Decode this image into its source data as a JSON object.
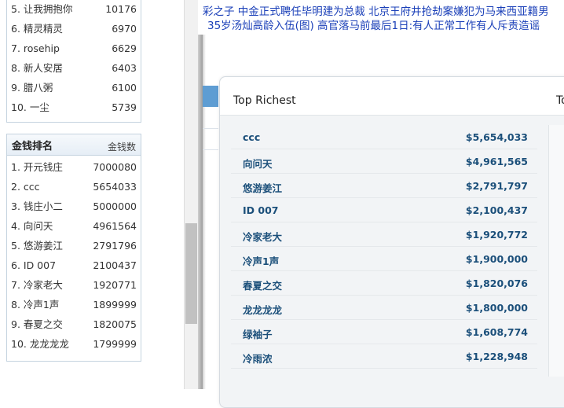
{
  "left_top_list": {
    "rows": [
      {
        "rank_name": "5. 让我拥抱你",
        "value": "10176"
      },
      {
        "rank_name": "6. 精灵精灵",
        "value": "6970"
      },
      {
        "rank_name": "7. rosehip",
        "value": "6629"
      },
      {
        "rank_name": "8. 新人安居",
        "value": "6403"
      },
      {
        "rank_name": "9. 腊八粥",
        "value": "6100"
      },
      {
        "rank_name": "10. 一尘",
        "value": "5739"
      }
    ]
  },
  "money_ranking": {
    "title": "金钱排名",
    "column_header": "金钱数",
    "rows": [
      {
        "rank_name": "1. 开元钱庄",
        "value": "7000080"
      },
      {
        "rank_name": "2. ccc",
        "value": "5654033"
      },
      {
        "rank_name": "3. 钱庄小二",
        "value": "5000000"
      },
      {
        "rank_name": "4. 向问天",
        "value": "4961564"
      },
      {
        "rank_name": "5. 悠游姜江",
        "value": "2791796"
      },
      {
        "rank_name": "6. ID 007",
        "value": "2100437"
      },
      {
        "rank_name": "7. 冷家老大",
        "value": "1920771"
      },
      {
        "rank_name": "8. 冷声1声",
        "value": "1899999"
      },
      {
        "rank_name": "9. 春夏之交",
        "value": "1820075"
      },
      {
        "rank_name": "10. 龙龙龙龙",
        "value": "1799999"
      }
    ]
  },
  "news_ticker": {
    "line1": "彩之子 中金正式聘任毕明建为总裁 北京王府井抢劫案嫌犯为马来西亚籍男",
    "line2": "35岁汤灿高龄入伍(图) 高官落马前最后1日:有人正常工作有人斥责造谣"
  },
  "top_richest": {
    "title": "Top Richest",
    "title_second_partial": "To",
    "rows": [
      {
        "name": "ccc",
        "amount": "$5,654,033"
      },
      {
        "name": "向问天",
        "amount": "$4,961,565"
      },
      {
        "name": "悠游姜江",
        "amount": "$2,791,797"
      },
      {
        "name": "ID 007",
        "amount": "$2,100,437"
      },
      {
        "name": "冷家老大",
        "amount": "$1,920,772"
      },
      {
        "name": "冷声1声",
        "amount": "$1,900,000"
      },
      {
        "name": "春夏之交",
        "amount": "$1,820,076"
      },
      {
        "name": "龙龙龙龙",
        "amount": "$1,800,000"
      },
      {
        "name": "绿袖子",
        "amount": "$1,608,774"
      },
      {
        "name": "冷雨浓",
        "amount": "$1,228,948"
      }
    ]
  },
  "colors": {
    "link_blue": "#1a3fb8",
    "table_text": "#1b4f7a",
    "panel_border": "#c5d3df",
    "accent_tab": "#5e9dd3"
  }
}
